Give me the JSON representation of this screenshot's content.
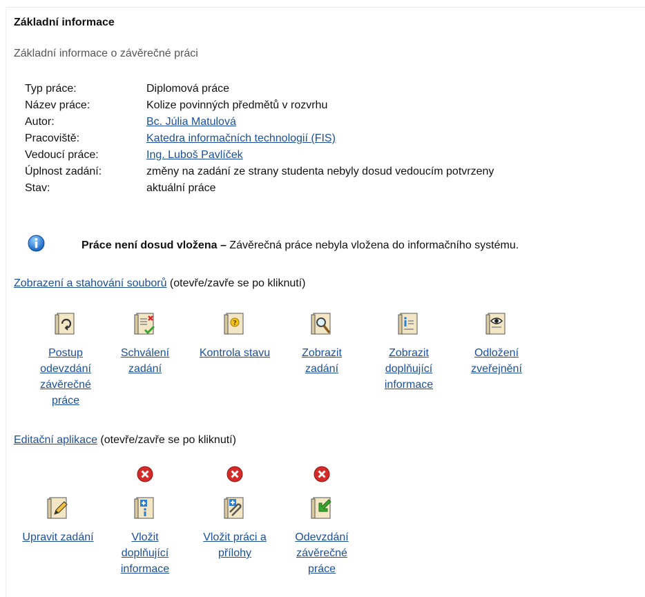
{
  "header": {
    "title": "Základní informace",
    "subtitle": "Základní informace o závěrečné práci"
  },
  "info": [
    {
      "key": "Typ práce:",
      "value": "Diplomová práce",
      "link": false
    },
    {
      "key": "Název práce:",
      "value": "Kolize povinných předmětů v rozvrhu",
      "link": false
    },
    {
      "key": "Autor:",
      "value": "Bc. Júlia Matulová",
      "link": true
    },
    {
      "key": "Pracoviště:",
      "value": "Katedra informačních technologií (FIS)",
      "link": true
    },
    {
      "key": "Vedoucí práce:",
      "value": "Ing. Luboš Pavlíček",
      "link": true
    },
    {
      "key": "Úplnost zadání:",
      "value": "změny na zadání ze strany studenta nebyly dosud vedoucím potvrzeny",
      "link": false
    },
    {
      "key": "Stav:",
      "value": "aktuální práce",
      "link": false
    }
  ],
  "notice": {
    "icon": "info-icon",
    "bold": "Práce není dosud vložena –",
    "text": " Závěrečná práce nebyla vložena do informačního systému."
  },
  "files_section": {
    "link": "Zobrazení a stahování souborů",
    "note": " (otevře/zavře se po kliknutí)",
    "items": [
      {
        "label": "Postup odevzdání závěrečné práce",
        "icon": "workflow-doc-icon"
      },
      {
        "label": "Schválení zadání",
        "icon": "approve-doc-icon"
      },
      {
        "label": "Kontrola stavu",
        "icon": "status-doc-icon"
      },
      {
        "label": "Zobrazit zadání",
        "icon": "search-doc-icon"
      },
      {
        "label": "Zobrazit doplňující informace",
        "icon": "info-doc-icon"
      },
      {
        "label": "Odložení zveřejnění",
        "icon": "eye-doc-icon"
      }
    ]
  },
  "edit_section": {
    "link": "Editační aplikace",
    "note": " (otevře/zavře se po kliknutí)",
    "items": [
      {
        "label": "Upravit zadání",
        "icon": "edit-doc-icon",
        "disabled": false
      },
      {
        "label": "Vložit doplňující informace",
        "icon": "add-info-doc-icon",
        "disabled": true
      },
      {
        "label": "Vložit práci a přílohy",
        "icon": "attach-doc-icon",
        "disabled": true
      },
      {
        "label": "Odevzdání závěrečné práce",
        "icon": "submit-doc-icon",
        "disabled": true
      }
    ]
  },
  "colors": {
    "link": "#1b4f9c",
    "info_icon": "#2b7fd6",
    "disabled_mark": "#d42a2a",
    "doc_bg": "#f2e6c4"
  }
}
